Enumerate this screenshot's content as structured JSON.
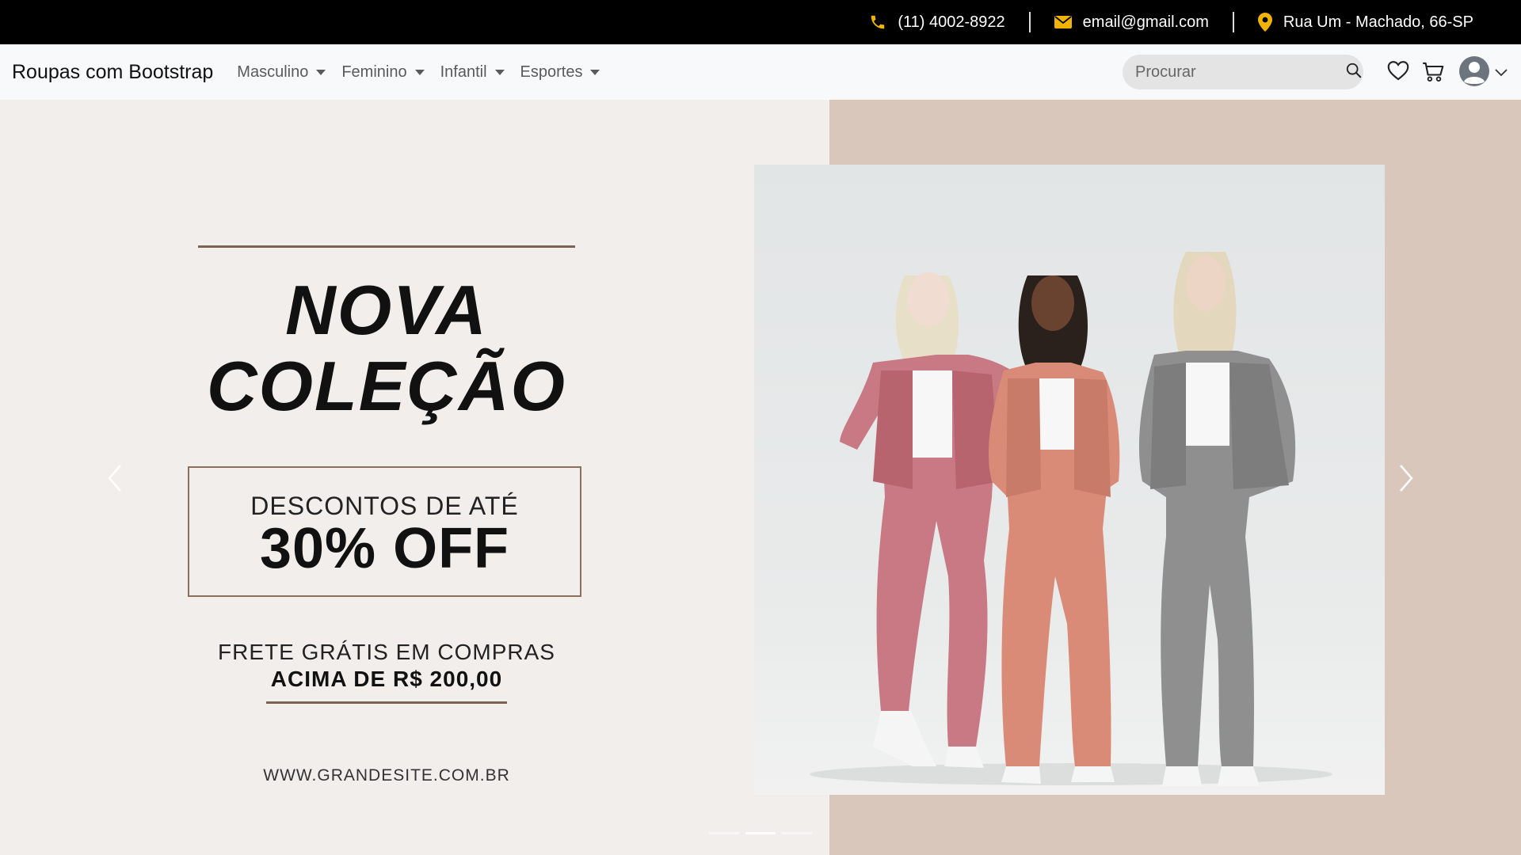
{
  "topbar": {
    "phone": "(11) 4002-8922",
    "email": "email@gmail.com",
    "address": "Rua Um - Machado, 66-SP",
    "icon_color": "#f0b400"
  },
  "navbar": {
    "brand": "Roupas com Bootstrap",
    "menu": [
      {
        "label": "Masculino"
      },
      {
        "label": "Feminino"
      },
      {
        "label": "Infantil"
      },
      {
        "label": "Esportes"
      }
    ],
    "search_placeholder": "Procurar",
    "icons": [
      "heart-icon",
      "cart-icon",
      "user-avatar-icon",
      "chevron-down-icon"
    ]
  },
  "carousel": {
    "promo": {
      "title_line1": "NOVA",
      "title_line2": "COLEÇÃO",
      "discount_small": "DESCONTOS DE ATÉ",
      "discount_big": "30% OFF",
      "frete": "FRETE GRÁTIS EM COMPRAS",
      "frete_value": "ACIMA DE R$ 200,00",
      "site": "WWW.GRANDESITE.COM.BR"
    },
    "active_index": 1,
    "slide_count": 3,
    "colors": {
      "left_bg": "#f1eeeb",
      "right_bg": "#d8c7ba",
      "accent_line": "#7b6453"
    }
  }
}
